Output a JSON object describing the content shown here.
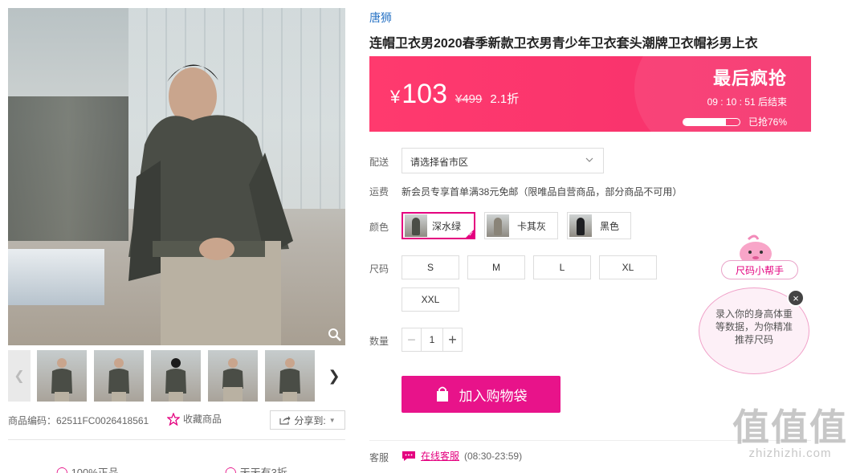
{
  "product": {
    "brand": "唐狮",
    "title": "连帽卫衣男2020春季新款卫衣男青少年卫衣套头潮牌卫衣帽衫男上衣",
    "code_label": "商品编码：62511FC0026418561",
    "favorite_label": "收藏商品",
    "share_label": "分享到:"
  },
  "gallery": {
    "main_image": "model in dark olive hoodie seated",
    "thumbnails": [
      "front view",
      "side view",
      "back view",
      "seated view",
      "detail view"
    ],
    "prev_icon": "chevron-left-icon",
    "next_icon": "chevron-right-icon",
    "zoom_icon": "magnifier-icon"
  },
  "price": {
    "currency": "¥",
    "current": "103",
    "original": "¥499",
    "discount": "2.1折",
    "flash_label": "最后疯抢",
    "timer": "09 : 10 : 51  后结束",
    "sold_label": "已抢76%",
    "sold_fraction": 0.76
  },
  "delivery": {
    "label": "配送",
    "region_placeholder": "请选择省市区"
  },
  "shipping": {
    "label": "运费",
    "text": "新会员专享首单满38元免邮（限唯品自营商品，部分商品不可用）"
  },
  "colors": {
    "label": "颜色",
    "options": [
      {
        "name": "深水绿",
        "selected": true,
        "swatch": "#4b4e47"
      },
      {
        "name": "卡其灰",
        "selected": false,
        "swatch": "#8a8478"
      },
      {
        "name": "黑色",
        "selected": false,
        "swatch": "#1e1f22"
      }
    ]
  },
  "sizes": {
    "label": "尺码",
    "options": [
      "S",
      "M",
      "L",
      "XL",
      "XXL"
    ]
  },
  "quantity": {
    "label": "数量",
    "value": "1",
    "minus": "−",
    "plus": "+"
  },
  "cart": {
    "button_label": "加入购物袋"
  },
  "service": {
    "label": "客服",
    "link_label": "在线客服",
    "hours": "(08:30-23:59)"
  },
  "guarantees": [
    "100%正品",
    "天天有3折"
  ],
  "size_helper": {
    "tag_label": "尺码小帮手",
    "bubble_text": "录入你的身高体重等数据，为你精准推荐尺码",
    "close": "×"
  },
  "watermark": {
    "big": "值值值",
    "small": "zhizhizhi.com"
  },
  "colors_theme": {
    "accent": "#e4007f",
    "price_bar": "#ff3a6e",
    "brand_link": "#2a74c5"
  }
}
